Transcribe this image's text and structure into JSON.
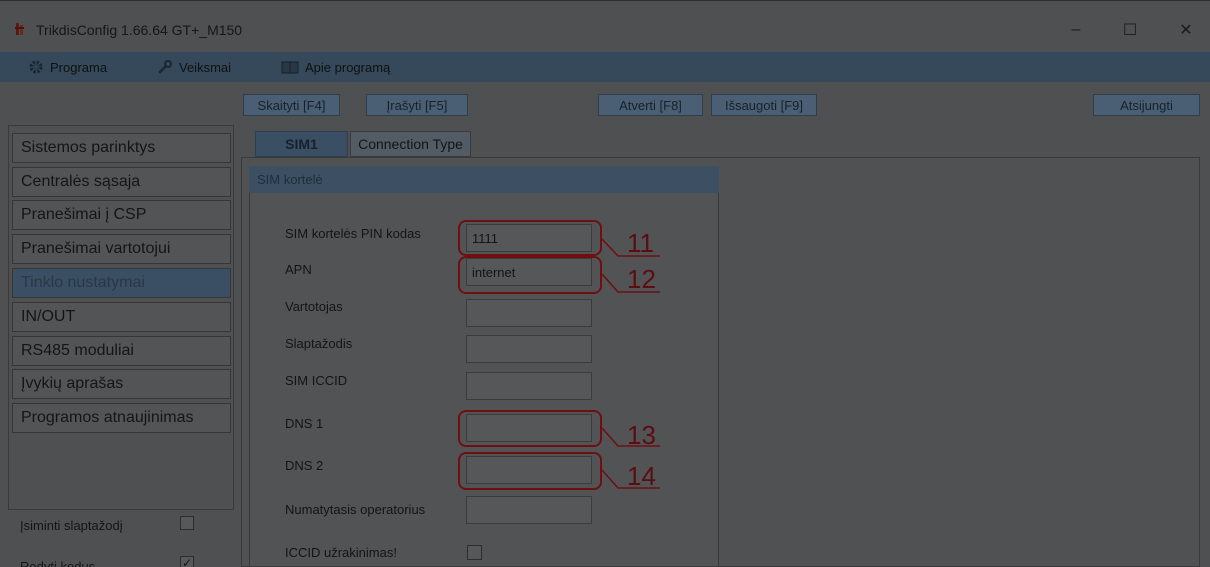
{
  "window": {
    "title": "TrikdisConfig 1.66.64   GT+_M150",
    "minimize_glyph": "–",
    "maximize_glyph": "☐",
    "close_glyph": "✕"
  },
  "menu": {
    "items": [
      {
        "label": "Programa",
        "icon": "gear-icon"
      },
      {
        "label": "Veiksmai",
        "icon": "wrench-icon"
      },
      {
        "label": "Apie programą",
        "icon": "book-icon"
      }
    ]
  },
  "toolbar": {
    "read_label": "Skaityti [F4]",
    "write_label": "Įrašyti [F5]",
    "open_label": "Atverti [F8]",
    "save_label": "Išsaugoti [F9]",
    "disconnect_label": "Atsijungti"
  },
  "nav": {
    "items": [
      {
        "label": "Sistemos parinktys",
        "active": false
      },
      {
        "label": "Centralės sąsaja",
        "active": false
      },
      {
        "label": "Pranešimai į CSP",
        "active": false
      },
      {
        "label": "Pranešimai vartotojui",
        "active": false
      },
      {
        "label": "Tinklo nustatymai",
        "active": true
      },
      {
        "label": "IN/OUT",
        "active": false
      },
      {
        "label": "RS485 moduliai",
        "active": false
      },
      {
        "label": "Įvykių aprašas",
        "active": false
      },
      {
        "label": "Programos atnaujinimas",
        "active": false
      }
    ],
    "remember_password_label": "Įsiminti slaptažodį",
    "remember_password_checked": false,
    "show_codes_label": "Rodyti kodus",
    "show_codes_checked": true,
    "check_glyph": "✓"
  },
  "tabs": [
    {
      "label": "SIM1",
      "active": true
    },
    {
      "label": "Connection Type",
      "active": false
    }
  ],
  "sim_card": {
    "group_title": "SIM kortelė",
    "fields": [
      {
        "label": "SIM kortelės PIN kodas",
        "value": "1111",
        "callout": "11"
      },
      {
        "label": "APN",
        "value": "internet",
        "callout": "12"
      },
      {
        "label": "Vartotojas",
        "value": ""
      },
      {
        "label": "Slaptažodis",
        "value": ""
      },
      {
        "label": "SIM ICCID",
        "value": ""
      },
      {
        "label": "DNS 1",
        "value": "",
        "callout": "13"
      },
      {
        "label": "DNS 2",
        "value": "",
        "callout": "14"
      },
      {
        "label": "Numatytasis operatorius",
        "value": ""
      }
    ],
    "iccid_lock_label": "ICCID užrakinimas!",
    "iccid_lock_checked": false
  },
  "colors": {
    "window_bg": "#4f5052",
    "menubar_bg": "#36495b",
    "accent_dark_blue": "#3a4f64",
    "callout_red": "#6e0f13"
  }
}
